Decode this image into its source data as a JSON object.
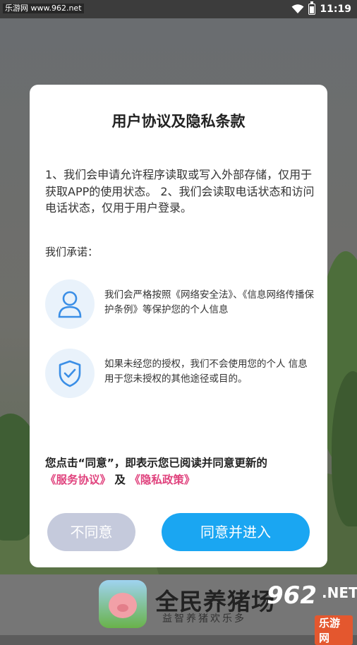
{
  "status_bar": {
    "watermark": "乐游网 www.962.net",
    "time": "11:19"
  },
  "dialog": {
    "title": "用户协议及隐私条款",
    "permission_text": "1、我们会申请允许程序读取或写入外部存储，仅用于获取APP的使用状态。 2、我们会读取电话状态和访问电话状态，仅用于用户登录。",
    "promise_heading": "我们承诺：",
    "features": [
      {
        "icon": "user-icon",
        "text": "我们会严格按照《网络安全法》、《信息网络传播保护条例》等保护您的个人信息"
      },
      {
        "icon": "shield-check-icon",
        "text": "如果未经您的授权，我们不会使用您的个人 信息用于您未授权的其他途径或目的。"
      }
    ],
    "notice_prefix": "您点击“同意”，即表示您已阅读并同意更新的",
    "service_link": "《服务协议》",
    "and": "及",
    "privacy_link": "《隐私政策》",
    "disagree_label": "不同意",
    "agree_label": "同意并进入"
  },
  "banner": {
    "app_name": "全民养猪场",
    "slogan": "益智养猪欢乐多",
    "watermark_num": "962",
    "watermark_net": ".NET",
    "watermark_cn": "乐游网"
  },
  "colors": {
    "accent": "#1aa6f2",
    "disabled_button": "#c5cadc",
    "link": "#e0427d",
    "icon_bg": "#e9f2fb",
    "icon_stroke": "#3a8ee6"
  }
}
